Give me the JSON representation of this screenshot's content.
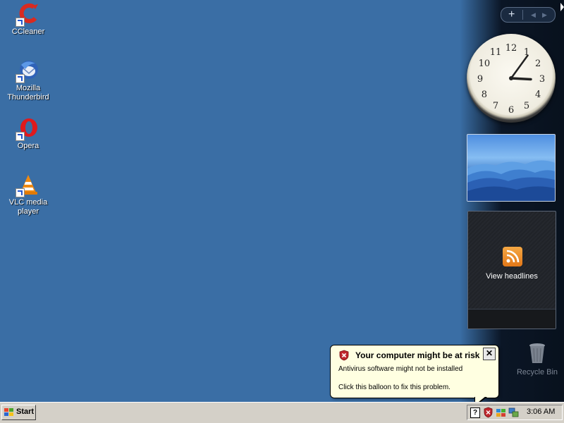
{
  "desktop": {
    "background_color": "#3a6ea5",
    "icons": [
      {
        "label": "CCleaner",
        "icon": "ccleaner-icon"
      },
      {
        "label": "Mozilla Thunderbird",
        "icon": "thunderbird-icon"
      },
      {
        "label": "Opera",
        "icon": "opera-icon"
      },
      {
        "label": "VLC media player",
        "icon": "vlc-icon"
      }
    ],
    "recycle_bin": {
      "label": "Recycle Bin",
      "icon": "recycle-bin-icon"
    }
  },
  "sidebar": {
    "controls": {
      "add": "+",
      "prev": "◀",
      "next": "▶"
    },
    "clock": {
      "hour": 3,
      "minute": 6,
      "numerals": [
        "12",
        "1",
        "2",
        "3",
        "4",
        "5",
        "6",
        "7",
        "8",
        "9",
        "10",
        "11"
      ]
    },
    "slideshow": {
      "icon": "mountain-landscape-image"
    },
    "feed": {
      "label": "View headlines",
      "icon": "rss-icon"
    }
  },
  "balloon": {
    "title": "Your computer might be at risk",
    "line1": "Antivirus software might not be installed",
    "line2": "Click this balloon to fix this problem.",
    "close": "✕",
    "icon": "security-shield-icon"
  },
  "taskbar": {
    "start_label": "Start",
    "help_glyph": "?",
    "time": "3:06 AM",
    "colors": {
      "taskbar": "#d4d0c8",
      "balloon_bg": "#ffffe1",
      "shield_red": "#c0272d"
    }
  }
}
